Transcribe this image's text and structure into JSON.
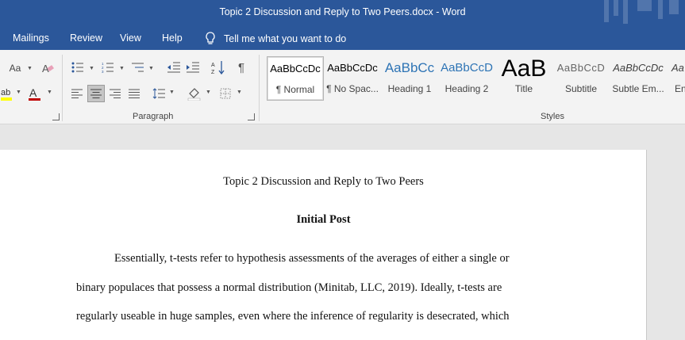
{
  "window": {
    "title": "Topic 2 Discussion and Reply to Two Peers.docx  -  Word"
  },
  "menu": {
    "items": [
      "Mailings",
      "Review",
      "View",
      "Help"
    ],
    "tell_me": "Tell me what you want to do"
  },
  "ribbon": {
    "groups": {
      "paragraph": "Paragraph",
      "styles": "Styles"
    },
    "font": {
      "change_case": "Aa"
    },
    "styles": [
      {
        "preview": "AaBbCcDc",
        "label": "¶ Normal"
      },
      {
        "preview": "AaBbCcDc",
        "label": "¶ No Spac..."
      },
      {
        "preview": "AaBbCc",
        "label": "Heading 1"
      },
      {
        "preview": "AaBbCcD",
        "label": "Heading 2"
      },
      {
        "preview": "AaB",
        "label": "Title"
      },
      {
        "preview": "AaBbCcD",
        "label": "Subtitle"
      },
      {
        "preview": "AaBbCcDc",
        "label": "Subtle Em..."
      },
      {
        "preview": "Aa",
        "label": "En"
      }
    ]
  },
  "document": {
    "title": "Topic 2 Discussion and Reply to Two Peers",
    "heading": "Initial Post",
    "lines": [
      "Essentially, t-tests refer to hypothesis assessments of the averages of either a single or",
      "binary populaces that possess a normal distribution (Minitab, LLC, 2019). Ideally, t-tests are",
      "regularly useable in huge samples, even where the inference of regularity is desecrated, which"
    ]
  },
  "colors": {
    "title_bar": "#2b579a",
    "ribbon": "#f3f3f3",
    "font_color": "#c00000",
    "highlight": "#ffff00",
    "heading_blue": "#2e74b5"
  }
}
